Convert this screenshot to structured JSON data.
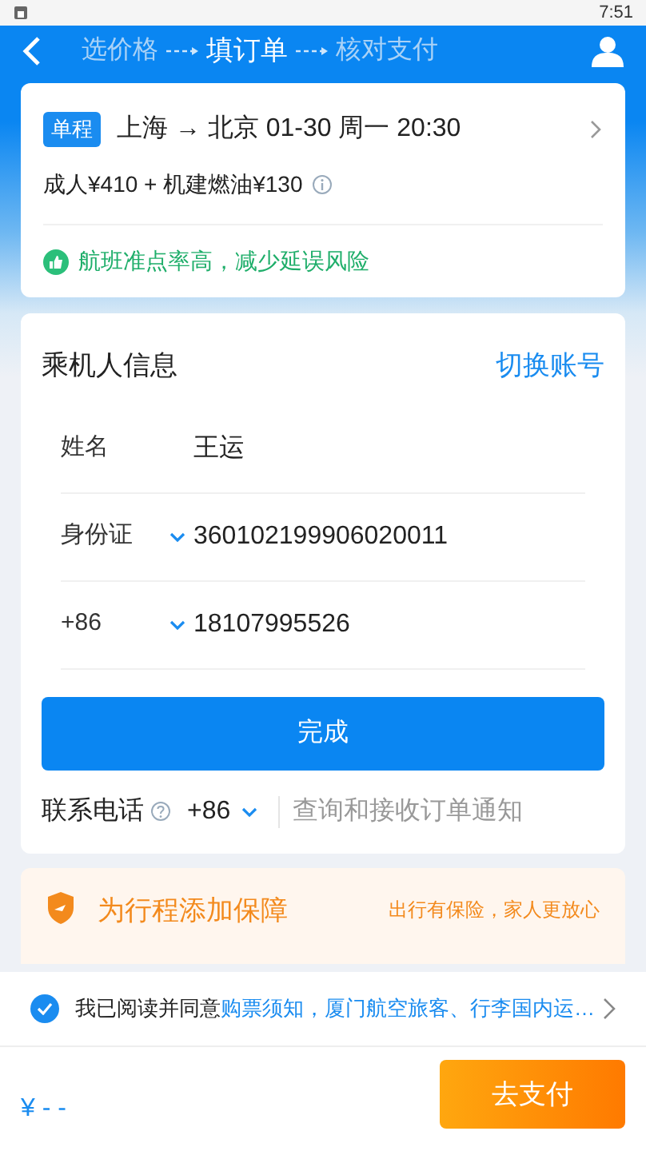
{
  "status_bar": {
    "time": "7:51"
  },
  "header": {
    "steps": [
      {
        "label": "选价格",
        "selected": false
      },
      {
        "label": "填订单",
        "selected": true
      },
      {
        "label": "核对支付",
        "selected": false
      }
    ]
  },
  "flight": {
    "trip_type": "单程",
    "route": "上海 → 北京 01-30 周一 20:30",
    "price": "成人¥410 + 机建燃油¥130",
    "notice": "航班准点率高，减少延误风险"
  },
  "passenger": {
    "title": "乘机人信息",
    "switch_account": "切换账号",
    "fields": [
      {
        "kind": "plain",
        "label": "姓名",
        "value": "王运"
      },
      {
        "kind": "dropdown",
        "label": "身份证",
        "value": "360102199906020011"
      },
      {
        "kind": "dropdown",
        "label": "+86",
        "value": "18107995526"
      }
    ],
    "done_button": "完成",
    "contact": {
      "label": "联系电话",
      "code": "+86",
      "placeholder": "查询和接收订单通知"
    }
  },
  "insurance": {
    "title": "为行程添加保障",
    "slogan": "出行有保险，家人更放心"
  },
  "agreement": {
    "checked": true,
    "prefix": "我已阅读并同意",
    "link": "购票须知，厦门航空旅客、行李国内运…"
  },
  "footer": {
    "price": "¥ - -",
    "pay_button": "去支付"
  }
}
